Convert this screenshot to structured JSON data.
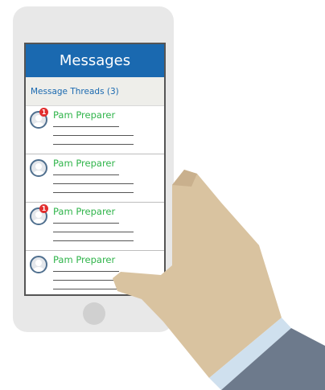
{
  "header": {
    "title": "Messages"
  },
  "subheader": {
    "label": "Message Threads (3)"
  },
  "threads": [
    {
      "name": "Pam Preparer",
      "badge": "1"
    },
    {
      "name": "Pam Preparer",
      "badge": ""
    },
    {
      "name": "Pam Preparer",
      "badge": "1"
    },
    {
      "name": "Pam Preparer",
      "badge": ""
    }
  ],
  "colors": {
    "header_bg": "#1a69b0",
    "sender_name": "#2fb44a",
    "badge": "#e12d2d",
    "skin": "#d9c3a0",
    "sleeve": "#6d7a8c",
    "cuff": "#cfe0ee"
  },
  "icons": {
    "avatar": "user-avatar-icon",
    "badge": "notification-badge-icon"
  }
}
